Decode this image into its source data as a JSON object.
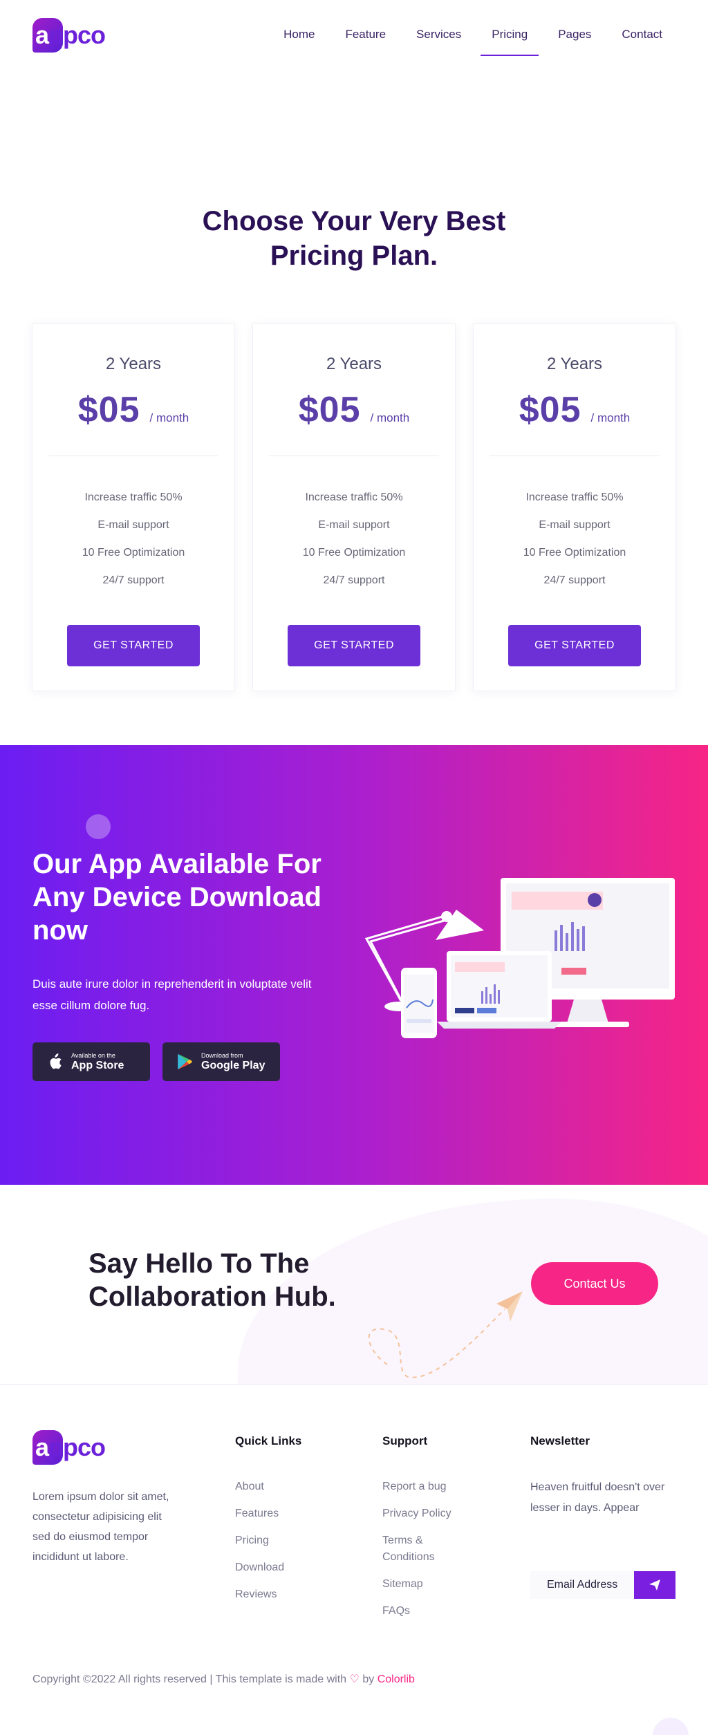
{
  "brand": {
    "logo_letter": "a",
    "logo_rest": "ppco"
  },
  "nav": [
    {
      "label": "Home",
      "active": false
    },
    {
      "label": "Feature",
      "active": false
    },
    {
      "label": "Services",
      "active": false
    },
    {
      "label": "Pricing",
      "active": true
    },
    {
      "label": "Pages",
      "active": false
    },
    {
      "label": "Contact",
      "active": false
    }
  ],
  "pricing": {
    "title_line1": "Choose Your Very Best",
    "title_line2": "Pricing Plan.",
    "plans": [
      {
        "name": "2 Years",
        "price": "$05",
        "period": "/ month",
        "features": [
          "Increase traffic 50%",
          "E-mail support",
          "10 Free Optimization",
          "24/7 support"
        ],
        "cta": "GET STARTED"
      },
      {
        "name": "2 Years",
        "price": "$05",
        "period": "/ month",
        "features": [
          "Increase traffic 50%",
          "E-mail support",
          "10 Free Optimization",
          "24/7 support"
        ],
        "cta": "GET STARTED"
      },
      {
        "name": "2 Years",
        "price": "$05",
        "period": "/ month",
        "features": [
          "Increase traffic 50%",
          "E-mail support",
          "10 Free Optimization",
          "24/7 support"
        ],
        "cta": "GET STARTED"
      }
    ]
  },
  "app": {
    "title": "Our App Available For Any Device Download now",
    "description": "Duis aute irure dolor in reprehenderit in voluptate velit esse cillum dolore fug.",
    "apple_small": "Available on the",
    "apple_big": "App Store",
    "google_small": "Download from",
    "google_big": "Google Play"
  },
  "collab": {
    "title_line1": "Say Hello To The",
    "title_line2": "Collaboration Hub.",
    "cta": "Contact Us"
  },
  "footer": {
    "about": "Lorem ipsum dolor sit amet, consectetur adipisicing elit sed do eiusmod tempor incididunt ut labore.",
    "quick_links_title": "Quick Links",
    "quick_links": [
      "About",
      "Features",
      "Pricing",
      "Download",
      "Reviews"
    ],
    "support_title": "Support",
    "support_links": [
      "Report a bug",
      "Privacy Policy",
      "Terms &",
      "Conditions",
      "Sitemap",
      "FAQs"
    ],
    "newsletter_title": "Newsletter",
    "newsletter_text": "Heaven fruitful doesn't over lesser in days. Appear",
    "email_placeholder": "Email Address",
    "copyright_prefix": "Copyright ©2022 All rights reserved | This template is made with",
    "copyright_by": "by",
    "copyright_brand": "Colorlib"
  },
  "colors": {
    "accent": "#6d2fd6",
    "pink": "#f72585",
    "dark": "#2a1054"
  }
}
